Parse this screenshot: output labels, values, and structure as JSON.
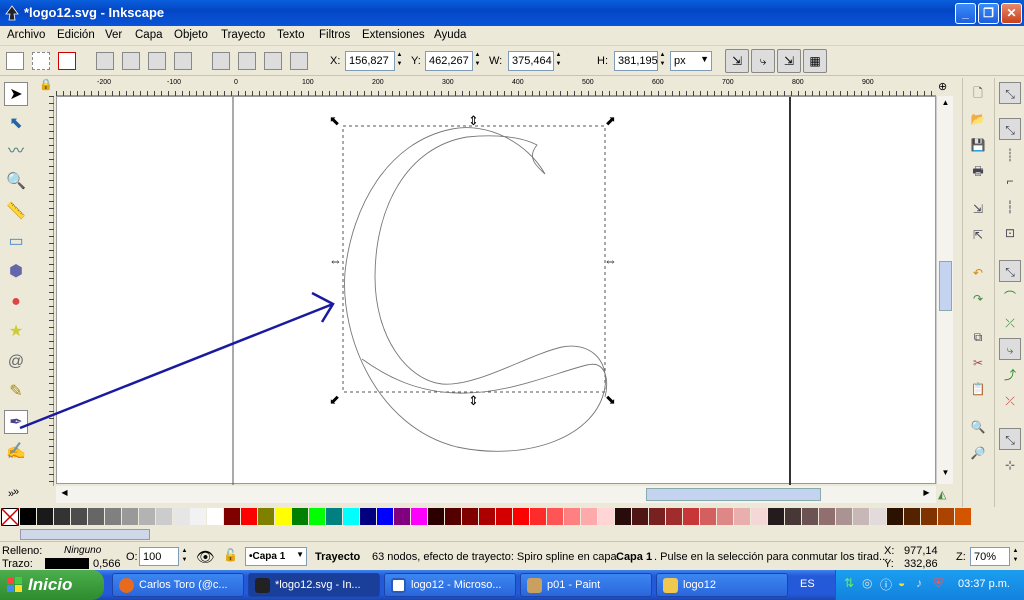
{
  "window": {
    "title": "*logo12.svg - Inkscape",
    "min_label": "_",
    "max_label": "❐",
    "close_label": "✕"
  },
  "menu": [
    "Archivo",
    "Edición",
    "Ver",
    "Capa",
    "Objeto",
    "Trayecto",
    "Texto",
    "Filtros",
    "Extensiones",
    "Ayuda"
  ],
  "toolbar": {
    "x_label": "X:",
    "x_value": "156,827",
    "y_label": "Y:",
    "y_value": "462,267",
    "w_label": "W:",
    "w_value": "375,464",
    "h_label": "H:",
    "h_value": "381,195",
    "unit": "px"
  },
  "ruler": {
    "h_ticks": [
      "-200",
      "-100",
      "0",
      "100",
      "200",
      "300",
      "400",
      "500",
      "600",
      "700",
      "800",
      "900"
    ],
    "v_ticks": [
      "0",
      "100",
      "200",
      "300",
      "400",
      "500",
      "600"
    ]
  },
  "colors": {
    "accent": "#0a5fdc",
    "selection_arrow": "#1a1aa0"
  },
  "palette": [
    "#000000",
    "#1a1a1a",
    "#333333",
    "#4d4d4d",
    "#666666",
    "#808080",
    "#999999",
    "#b3b3b3",
    "#cccccc",
    "#e6e6e6",
    "#f2f2f2",
    "#ffffff",
    "#800000",
    "#ff0000",
    "#808000",
    "#ffff00",
    "#008000",
    "#00ff00",
    "#008080",
    "#00ffff",
    "#000080",
    "#0000ff",
    "#800080",
    "#ff00ff",
    "#2b0000",
    "#550000",
    "#800000",
    "#aa0000",
    "#d40000",
    "#ff0000",
    "#ff2a2a",
    "#ff5555",
    "#ff8080",
    "#ffaaaa",
    "#ffd5d5",
    "#280b0b",
    "#501616",
    "#782121",
    "#a02c2c",
    "#c83737",
    "#d35f5f",
    "#de8787",
    "#e9afaf",
    "#f4d7d7",
    "#241c1c",
    "#483737",
    "#6c5353",
    "#916f6f",
    "#ac9393",
    "#c8b7b7",
    "#e3dbdb",
    "#2b1100",
    "#552200",
    "#803300",
    "#aa4400",
    "#d45500"
  ],
  "status": {
    "fill_label": "Relleno:",
    "fill_value": "Ninguno",
    "stroke_label": "Trazo:",
    "stroke_width": "0,566",
    "opacity_label": "O:",
    "opacity_value": "100",
    "layer": "•Capa 1",
    "message_bold": "Trayecto",
    "message_text": "63 nodos, efecto de trayecto: Spiro spline en capa",
    "message_layer": "Capa 1",
    "message_tail": ". Pulse en la selección para conmutar los tirad...",
    "x_coord_label": "X:",
    "x_coord": "977,14",
    "y_coord_label": "Y:",
    "y_coord": "332,86",
    "zoom_label": "Z:",
    "zoom": "70%"
  },
  "taskbar": {
    "start": "Inicio",
    "tasks": [
      "Carlos Toro (@c...",
      "*logo12.svg - In...",
      "logo12 - Microso...",
      "p01 - Paint",
      "logo12"
    ],
    "lang": "ES",
    "clock": "03:37 p.m."
  }
}
